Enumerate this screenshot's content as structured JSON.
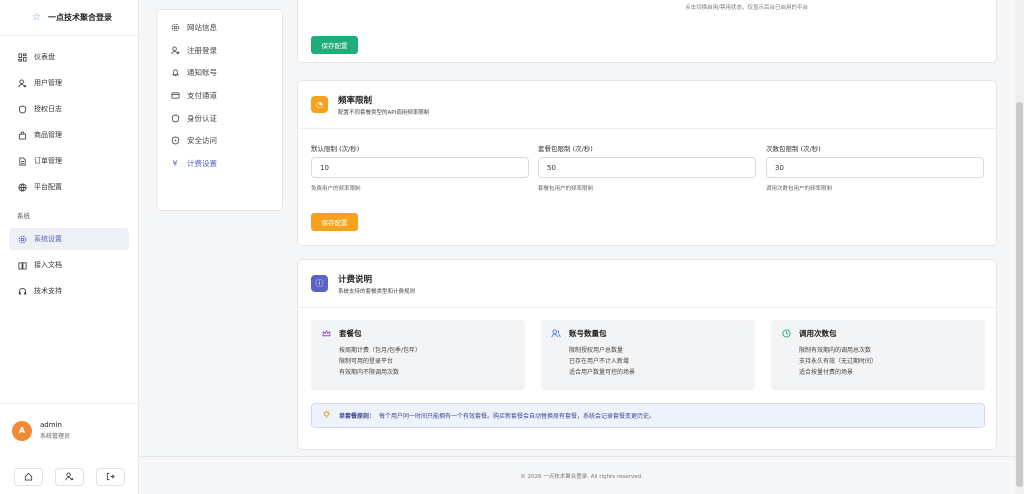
{
  "brand": {
    "title": "一点技术聚合登录",
    "icon": "star-icon"
  },
  "nav": {
    "items": [
      {
        "label": "仪表盘",
        "icon": "dashboard-icon"
      },
      {
        "label": "用户管理",
        "icon": "user-manage-icon"
      },
      {
        "label": "授权日志",
        "icon": "shield-log-icon"
      },
      {
        "label": "商品管理",
        "icon": "bag-icon"
      },
      {
        "label": "订单管理",
        "icon": "order-icon"
      },
      {
        "label": "平台配置",
        "icon": "globe-icon"
      }
    ],
    "section_label": "系统",
    "system_items": [
      {
        "label": "系统设置",
        "icon": "gear-icon",
        "active": true
      },
      {
        "label": "接入文档",
        "icon": "book-icon"
      },
      {
        "label": "技术支持",
        "icon": "headset-icon"
      }
    ]
  },
  "user": {
    "avatar_letter": "A",
    "name": "admin",
    "role": "系统管理员"
  },
  "settings_menu": {
    "items": [
      {
        "label": "网站信息",
        "icon": "gear-icon"
      },
      {
        "label": "注册登录",
        "icon": "user-add-icon"
      },
      {
        "label": "通知账号",
        "icon": "bell-icon"
      },
      {
        "label": "支付通道",
        "icon": "card-icon"
      },
      {
        "label": "身份认证",
        "icon": "shield-icon"
      },
      {
        "label": "安全访问",
        "icon": "lock-shield-icon"
      },
      {
        "label": "计费设置",
        "icon": "yen-icon",
        "active": true
      }
    ]
  },
  "top_card": {
    "hint": "点击切换启用/禁用状态，仅显示后台已启用的平台",
    "save_label": "保存配置"
  },
  "rate_card": {
    "title": "频率限制",
    "subtitle": "配置不同套餐类型的API调用频率限制",
    "fields": [
      {
        "label": "默认限制 (次/秒)",
        "value": "10",
        "help": "免费用户的频率限制"
      },
      {
        "label": "套餐包限制 (次/秒)",
        "value": "50",
        "help": "套餐包用户的频率限制"
      },
      {
        "label": "次数包限制 (次/秒)",
        "value": "30",
        "help": "调用次数包用户的频率限制"
      }
    ],
    "save_label": "保存配置"
  },
  "billing_card": {
    "title": "计费说明",
    "subtitle": "系统支持的套餐类型和计费规则",
    "plans": [
      {
        "title": "套餐包",
        "icon": "crown-icon",
        "lines": [
          "按周期计费（包月/包季/包年）",
          "限制可用的登录平台",
          "有效期内不限调用次数"
        ]
      },
      {
        "title": "账号数量包",
        "icon": "users-icon",
        "lines": [
          "限制授权用户总数量",
          "已存在用户不计入新增",
          "适合用户数量可控的场景"
        ]
      },
      {
        "title": "调用次数包",
        "icon": "clock-icon",
        "lines": [
          "限制有效期内的调用总次数",
          "支持永久有效（无过期时间）",
          "适合按量付费的场景"
        ]
      }
    ],
    "notice_bold": "单套餐原则：",
    "notice_text": "每个用户同一时间只能拥有一个有效套餐。购买新套餐会自动替换原有套餐，系统会记录套餐变更历史。"
  },
  "footer": {
    "text": "© 2026 一点技术聚合登录. All rights reserved."
  },
  "colors": {
    "accent": "#5b63c8",
    "green": "#1fae7a",
    "orange": "#f5a21f",
    "avatar": "#f08a34"
  }
}
